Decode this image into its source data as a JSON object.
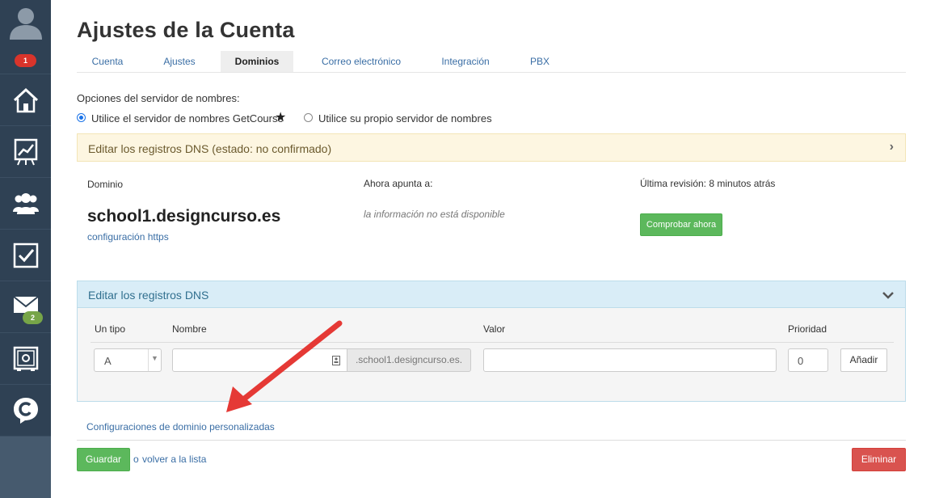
{
  "sidebar": {
    "notifications_badge": "1",
    "messages_badge": "2",
    "items": [
      {
        "icon": "home-icon"
      },
      {
        "icon": "chart-icon"
      },
      {
        "icon": "users-icon"
      },
      {
        "icon": "tasks-icon"
      },
      {
        "icon": "mail-icon"
      },
      {
        "icon": "safe-icon"
      },
      {
        "icon": "getcourse-logo-icon"
      }
    ]
  },
  "page": {
    "title": "Ajustes de la Cuenta",
    "tabs": [
      {
        "label": "Cuenta",
        "active": false
      },
      {
        "label": "Ajustes",
        "active": false
      },
      {
        "label": "Dominios",
        "active": true
      },
      {
        "label": "Correo electrónico",
        "active": false
      },
      {
        "label": "Integración",
        "active": false
      },
      {
        "label": "PBX",
        "active": false
      }
    ]
  },
  "nameserver": {
    "label": "Opciones del servidor de nombres:",
    "option_getcourse": "Utilice el servidor de nombres GetCourse",
    "option_own": "Utilice su propio servidor de nombres",
    "selected": "getcourse"
  },
  "dns_status_panel": {
    "title": "Editar los registros DNS (estado: no confirmado)",
    "domain_label": "Dominio",
    "domain_value": "school1.designcurso.es",
    "https_link": "configuración https",
    "points_to_label": "Ahora apunta a:",
    "points_to_value": "la información no está disponible",
    "last_check_label": "Última revisión: 8 minutos atrás",
    "check_now_button": "Comprobar ahora"
  },
  "dns_edit_panel": {
    "title": "Editar los registros DNS",
    "columns": {
      "type": "Un tipo",
      "name": "Nombre",
      "value": "Valor",
      "priority": "Prioridad"
    },
    "type_value": "A",
    "name_value": "",
    "domain_suffix": ".school1.designcurso.es.",
    "value_value": "",
    "priority_value": "0",
    "add_button": "Añadir"
  },
  "custom_config_link": "Configuraciones de dominio personalizadas",
  "footer": {
    "save_button": "Guardar",
    "or_text": "o",
    "back_link": "volver a la lista",
    "delete_button": "Eliminar"
  },
  "colors": {
    "sidebar_bg": "#2f4154",
    "accent_green": "#5cb85c",
    "danger_red": "#d9534f",
    "annotation_arrow": "#e53935"
  }
}
